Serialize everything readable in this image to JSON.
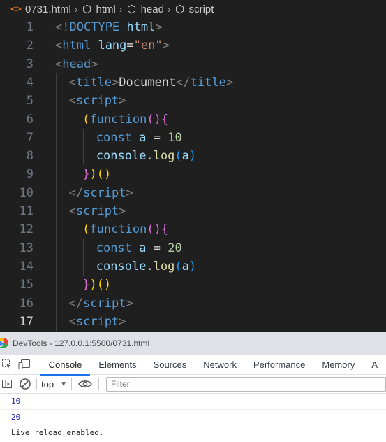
{
  "breadcrumb": {
    "items": [
      {
        "label": "0731.html",
        "icon": "html-file-icon"
      },
      {
        "label": "html",
        "icon": "symbol-element-icon"
      },
      {
        "label": "head",
        "icon": "symbol-element-icon"
      },
      {
        "label": "script",
        "icon": "symbol-element-icon"
      }
    ]
  },
  "editor": {
    "active_line": 17,
    "lines": [
      {
        "num": "1",
        "indent": 0,
        "tokens": [
          {
            "t": "<!",
            "c": "br"
          },
          {
            "t": "DOCTYPE",
            "c": "tag"
          },
          {
            "t": " ",
            "c": "txt"
          },
          {
            "t": "html",
            "c": "attr"
          },
          {
            "t": ">",
            "c": "br"
          }
        ]
      },
      {
        "num": "2",
        "indent": 0,
        "tokens": [
          {
            "t": "<",
            "c": "br"
          },
          {
            "t": "html",
            "c": "tag"
          },
          {
            "t": " ",
            "c": "txt"
          },
          {
            "t": "lang",
            "c": "attr"
          },
          {
            "t": "=",
            "c": "txt"
          },
          {
            "t": "\"en\"",
            "c": "str"
          },
          {
            "t": ">",
            "c": "br"
          }
        ]
      },
      {
        "num": "3",
        "indent": 0,
        "tokens": [
          {
            "t": "<",
            "c": "br"
          },
          {
            "t": "head",
            "c": "tag"
          },
          {
            "t": ">",
            "c": "br"
          }
        ]
      },
      {
        "num": "4",
        "indent": 1,
        "tokens": [
          {
            "t": "<",
            "c": "br"
          },
          {
            "t": "title",
            "c": "tag"
          },
          {
            "t": ">",
            "c": "br"
          },
          {
            "t": "Document",
            "c": "txt"
          },
          {
            "t": "</",
            "c": "br"
          },
          {
            "t": "title",
            "c": "tag"
          },
          {
            "t": ">",
            "c": "br"
          }
        ]
      },
      {
        "num": "5",
        "indent": 1,
        "tokens": [
          {
            "t": "<",
            "c": "br"
          },
          {
            "t": "script",
            "c": "tag"
          },
          {
            "t": ">",
            "c": "br"
          }
        ]
      },
      {
        "num": "6",
        "indent": 2,
        "tokens": [
          {
            "t": "(",
            "c": "p1"
          },
          {
            "t": "function",
            "c": "kw"
          },
          {
            "t": "()",
            "c": "p2"
          },
          {
            "t": "{",
            "c": "p2"
          }
        ]
      },
      {
        "num": "7",
        "indent": 3,
        "tokens": [
          {
            "t": "const",
            "c": "kw"
          },
          {
            "t": " ",
            "c": "txt"
          },
          {
            "t": "a",
            "c": "var"
          },
          {
            "t": " = ",
            "c": "txt"
          },
          {
            "t": "10",
            "c": "num"
          }
        ]
      },
      {
        "num": "8",
        "indent": 3,
        "tokens": [
          {
            "t": "console",
            "c": "var"
          },
          {
            "t": ".",
            "c": "txt"
          },
          {
            "t": "log",
            "c": "fn"
          },
          {
            "t": "(",
            "c": "p3"
          },
          {
            "t": "a",
            "c": "var"
          },
          {
            "t": ")",
            "c": "p3"
          }
        ]
      },
      {
        "num": "9",
        "indent": 2,
        "tokens": [
          {
            "t": "}",
            "c": "p2"
          },
          {
            "t": ")",
            "c": "p1"
          },
          {
            "t": "()",
            "c": "p1"
          }
        ]
      },
      {
        "num": "10",
        "indent": 1,
        "tokens": [
          {
            "t": "</",
            "c": "br"
          },
          {
            "t": "script",
            "c": "tag"
          },
          {
            "t": ">",
            "c": "br"
          }
        ]
      },
      {
        "num": "11",
        "indent": 1,
        "tokens": [
          {
            "t": "<",
            "c": "br"
          },
          {
            "t": "script",
            "c": "tag"
          },
          {
            "t": ">",
            "c": "br"
          }
        ]
      },
      {
        "num": "12",
        "indent": 2,
        "tokens": [
          {
            "t": "(",
            "c": "p1"
          },
          {
            "t": "function",
            "c": "kw"
          },
          {
            "t": "()",
            "c": "p2"
          },
          {
            "t": "{",
            "c": "p2"
          }
        ]
      },
      {
        "num": "13",
        "indent": 3,
        "tokens": [
          {
            "t": "const",
            "c": "kw"
          },
          {
            "t": " ",
            "c": "txt"
          },
          {
            "t": "a",
            "c": "var"
          },
          {
            "t": " = ",
            "c": "txt"
          },
          {
            "t": "20",
            "c": "num"
          }
        ]
      },
      {
        "num": "14",
        "indent": 3,
        "tokens": [
          {
            "t": "console",
            "c": "var"
          },
          {
            "t": ".",
            "c": "txt"
          },
          {
            "t": "log",
            "c": "fn"
          },
          {
            "t": "(",
            "c": "p3"
          },
          {
            "t": "a",
            "c": "var"
          },
          {
            "t": ")",
            "c": "p3"
          }
        ]
      },
      {
        "num": "15",
        "indent": 2,
        "tokens": [
          {
            "t": "}",
            "c": "p2"
          },
          {
            "t": ")",
            "c": "p1"
          },
          {
            "t": "()",
            "c": "p1"
          }
        ]
      },
      {
        "num": "16",
        "indent": 1,
        "tokens": [
          {
            "t": "</",
            "c": "br"
          },
          {
            "t": "script",
            "c": "tag"
          },
          {
            "t": ">",
            "c": "br"
          }
        ]
      },
      {
        "num": "17",
        "indent": 1,
        "tokens": [
          {
            "t": "<",
            "c": "br"
          },
          {
            "t": "script",
            "c": "tag"
          },
          {
            "t": ">",
            "c": "br"
          }
        ]
      }
    ]
  },
  "devtools": {
    "title": "DevTools - 127.0.0.1:5500/0731.html",
    "tabs": [
      {
        "label": "Console",
        "active": true
      },
      {
        "label": "Elements",
        "active": false
      },
      {
        "label": "Sources",
        "active": false
      },
      {
        "label": "Network",
        "active": false
      },
      {
        "label": "Performance",
        "active": false
      },
      {
        "label": "Memory",
        "active": false
      },
      {
        "label": "A",
        "active": false
      }
    ],
    "context": "top",
    "filter_placeholder": "Filter",
    "messages": [
      {
        "text": "10",
        "kind": "num"
      },
      {
        "text": "20",
        "kind": "num"
      },
      {
        "text": "Live reload enabled.",
        "kind": "txt"
      }
    ]
  },
  "colors": {
    "editor_bg": "#1f1f1f",
    "keyword": "#569cd6",
    "string": "#ce9178",
    "number": "#b5cea8",
    "accent": "#1a73e8"
  }
}
